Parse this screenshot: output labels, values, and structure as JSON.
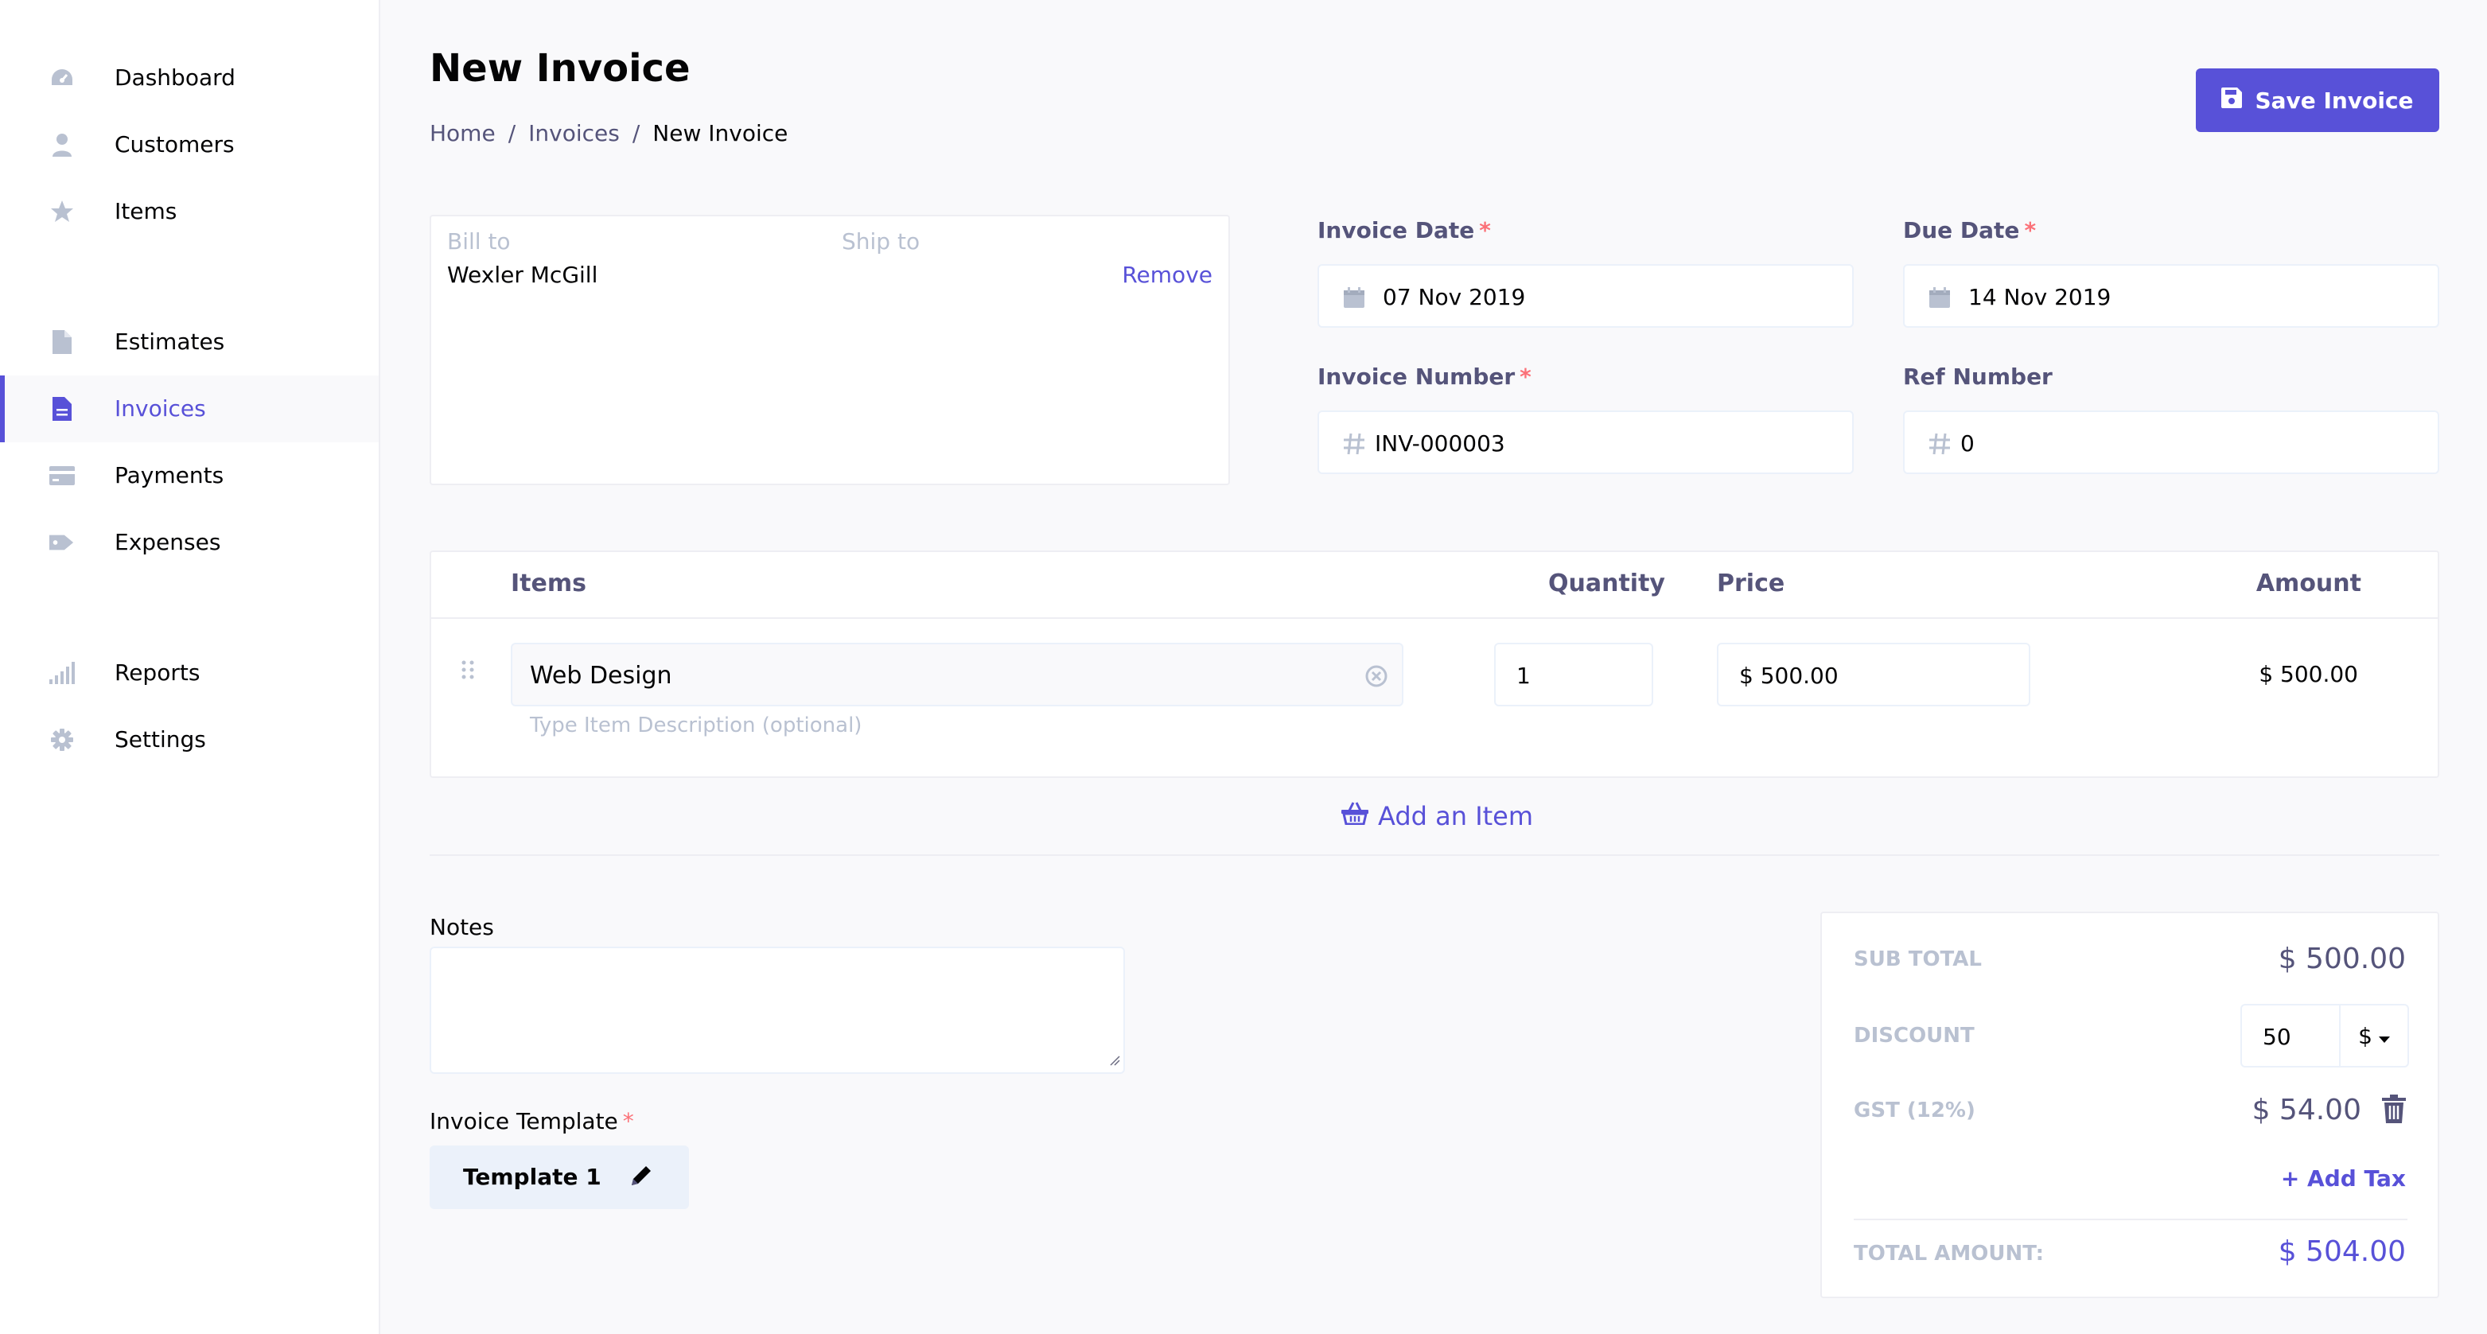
{
  "sidebar": {
    "items": [
      {
        "label": "Dashboard",
        "icon": "dashboard-icon"
      },
      {
        "label": "Customers",
        "icon": "user-icon"
      },
      {
        "label": "Items",
        "icon": "star-icon"
      },
      {
        "label": "Estimates",
        "icon": "file-icon"
      },
      {
        "label": "Invoices",
        "icon": "invoice-icon",
        "active": true
      },
      {
        "label": "Payments",
        "icon": "credit-card-icon"
      },
      {
        "label": "Expenses",
        "icon": "tag-icon"
      },
      {
        "label": "Reports",
        "icon": "bar-chart-icon"
      },
      {
        "label": "Settings",
        "icon": "gear-icon"
      }
    ]
  },
  "header": {
    "title": "New Invoice",
    "breadcrumb": [
      "Home",
      "Invoices",
      "New Invoice"
    ],
    "breadcrumb_separator": "/",
    "save_label": "Save Invoice"
  },
  "customer": {
    "bill_to_label": "Bill to",
    "ship_to_label": "Ship to",
    "name": "Wexler McGill",
    "remove_label": "Remove"
  },
  "fields": {
    "invoice_date": {
      "label": "Invoice Date",
      "required_mark": "*",
      "value": "07 Nov 2019"
    },
    "due_date": {
      "label": "Due Date",
      "required_mark": "*",
      "value": "14 Nov 2019"
    },
    "invoice_number": {
      "label": "Invoice Number",
      "required_mark": "*",
      "value": "INV-000003"
    },
    "ref_number": {
      "label": "Ref Number",
      "value": "0"
    }
  },
  "items_table": {
    "headers": {
      "items": "Items",
      "quantity": "Quantity",
      "price": "Price",
      "amount": "Amount"
    },
    "rows": [
      {
        "name": "Web Design",
        "description_placeholder": "Type Item Description (optional)",
        "quantity": "1",
        "price": "$ 500.00",
        "amount": "$ 500.00"
      }
    ],
    "add_item_label": "Add an Item"
  },
  "notes": {
    "label": "Notes",
    "value": ""
  },
  "template": {
    "label": "Invoice Template",
    "required_mark": "*",
    "value": "Template 1"
  },
  "totals": {
    "sub_total_label": "SUB TOTAL",
    "sub_total": "$ 500.00",
    "discount_label": "DISCOUNT",
    "discount_value": "50",
    "discount_type": "$",
    "tax_label": "GST (12%)",
    "tax_value": "$ 54.00",
    "add_tax_label": "+ Add Tax",
    "total_label": "TOTAL AMOUNT:",
    "total_value": "$ 504.00"
  },
  "colors": {
    "primary": "#5851d8",
    "required": "#fb7178",
    "muted": "#b9c1d1",
    "label": "#55547a"
  }
}
